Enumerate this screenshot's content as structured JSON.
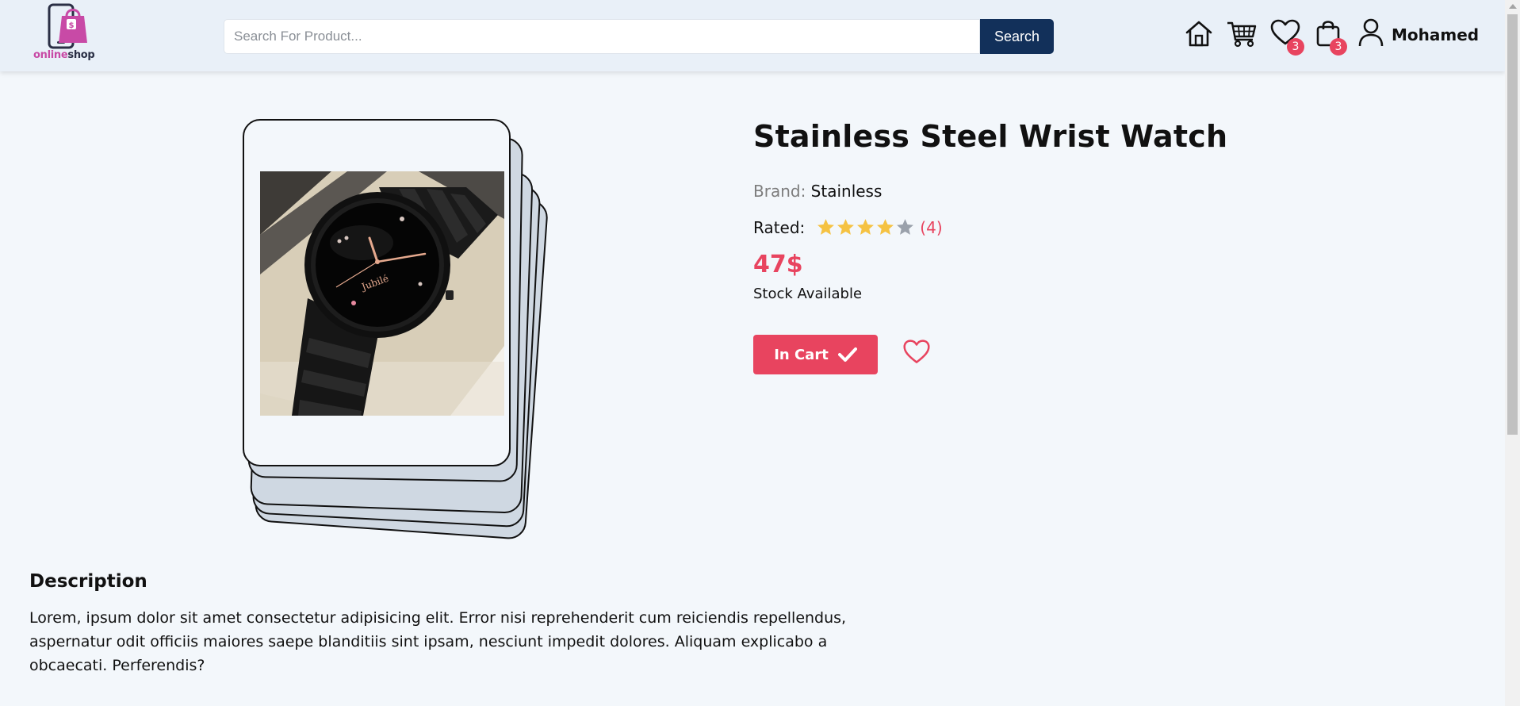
{
  "header": {
    "logo": {
      "text_part1": "online",
      "text_part2": "shop",
      "brand_color": "#c84aa6"
    },
    "search": {
      "placeholder": "Search For Product...",
      "value": "",
      "button_label": "Search"
    },
    "nav": [
      {
        "name": "home",
        "icon": "home-icon"
      },
      {
        "name": "products",
        "icon": "cart-icon"
      },
      {
        "name": "wishlist",
        "icon": "heart-icon",
        "badge": "3"
      },
      {
        "name": "cart",
        "icon": "shopping-bag-icon",
        "badge": "3"
      },
      {
        "name": "account",
        "icon": "user-icon"
      }
    ],
    "user_name": "Mohamed"
  },
  "product": {
    "title": "Stainless Steel Wrist Watch",
    "brand_label": "Brand:",
    "brand": "Stainless",
    "rated_label": "Rated:",
    "rating": 4,
    "rating_max": 5,
    "rating_count": "(4)",
    "price": "47$",
    "stock": "Stock Available",
    "cart_button_label": "In Cart",
    "image_alt": "black wrist watch",
    "watch_brand_mark": "Jubilé"
  },
  "description": {
    "title": "Description",
    "text": "Lorem, ipsum dolor sit amet consectetur adipisicing elit. Error nisi reprehenderit cum reiciendis repellendus, aspernatur odit officiis maiores saepe blanditiis sint ipsam, nesciunt impedit dolores. Aliquam explicabo a obcaecati. Perferendis?"
  },
  "colors": {
    "accent": "#e8445f",
    "navy": "#12305a",
    "header_bg": "#e9f0f8",
    "page_bg": "#f3f7fb",
    "star_filled": "#f5c242",
    "star_empty": "#9aa1ab"
  }
}
